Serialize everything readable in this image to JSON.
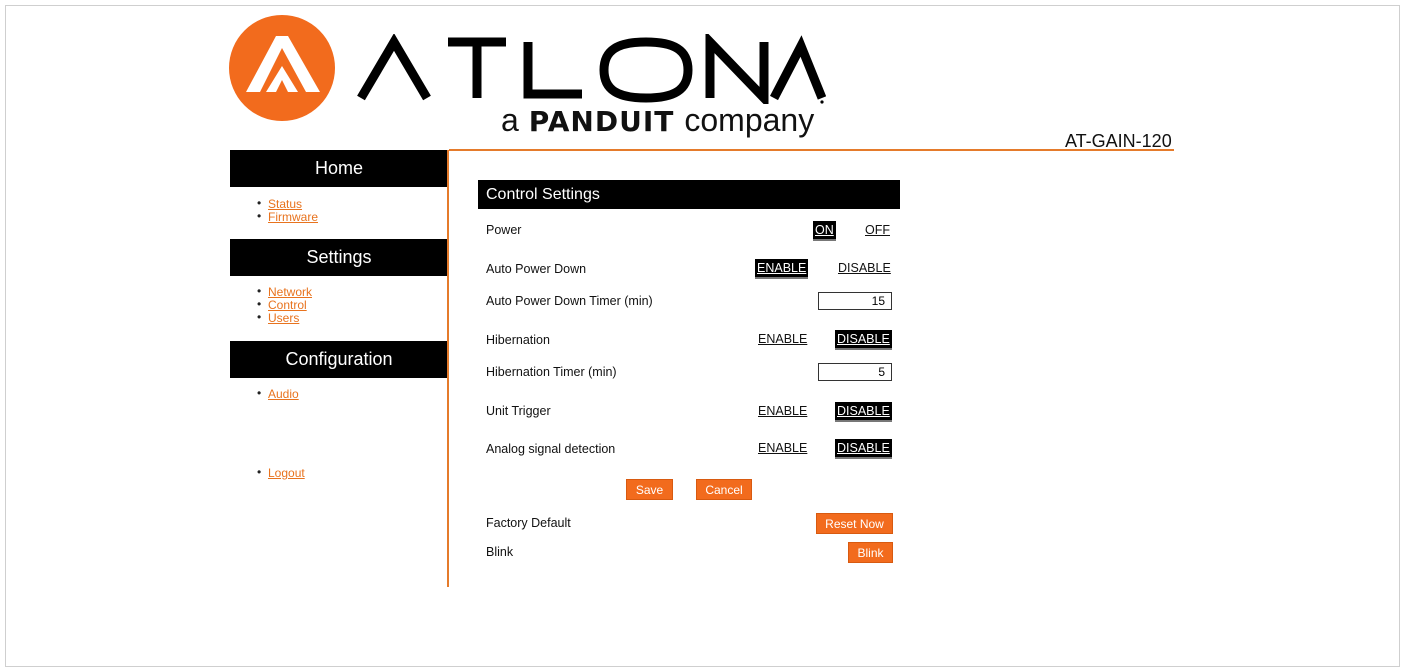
{
  "brand": {
    "wordmark": "ATLONA",
    "tagline_prefix": "a",
    "tagline_brand": "PANDUIT",
    "tagline_suffix": "company",
    "accent": "#f26b1d"
  },
  "model": "AT-GAIN-120",
  "sidebar": {
    "sections": [
      {
        "title": "Home",
        "links": [
          "Status",
          "Firmware"
        ]
      },
      {
        "title": "Settings",
        "links": [
          "Network",
          "Control",
          "Users"
        ]
      },
      {
        "title": "Configuration",
        "links": [
          "Audio"
        ]
      }
    ],
    "logout": "Logout"
  },
  "panel": {
    "title": "Control Settings",
    "rows": {
      "power": {
        "label": "Power",
        "on": "ON",
        "off": "OFF",
        "selected": "ON"
      },
      "auto_power_down": {
        "label": "Auto Power Down",
        "enable": "ENABLE",
        "disable": "DISABLE",
        "selected": "ENABLE"
      },
      "auto_power_down_timer": {
        "label": "Auto Power Down Timer (min)",
        "value": "15"
      },
      "hibernation": {
        "label": "Hibernation",
        "enable": "ENABLE",
        "disable": "DISABLE",
        "selected": "DISABLE"
      },
      "hibernation_timer": {
        "label": "Hibernation Timer (min)",
        "value": "5"
      },
      "unit_trigger": {
        "label": "Unit Trigger",
        "enable": "ENABLE",
        "disable": "DISABLE",
        "selected": "DISABLE"
      },
      "analog_detection": {
        "label": "Analog signal detection",
        "enable": "ENABLE",
        "disable": "DISABLE",
        "selected": "DISABLE"
      }
    },
    "save": "Save",
    "cancel": "Cancel",
    "factory_default": {
      "label": "Factory Default",
      "button": "Reset Now"
    },
    "blink": {
      "label": "Blink",
      "button": "Blink"
    }
  }
}
